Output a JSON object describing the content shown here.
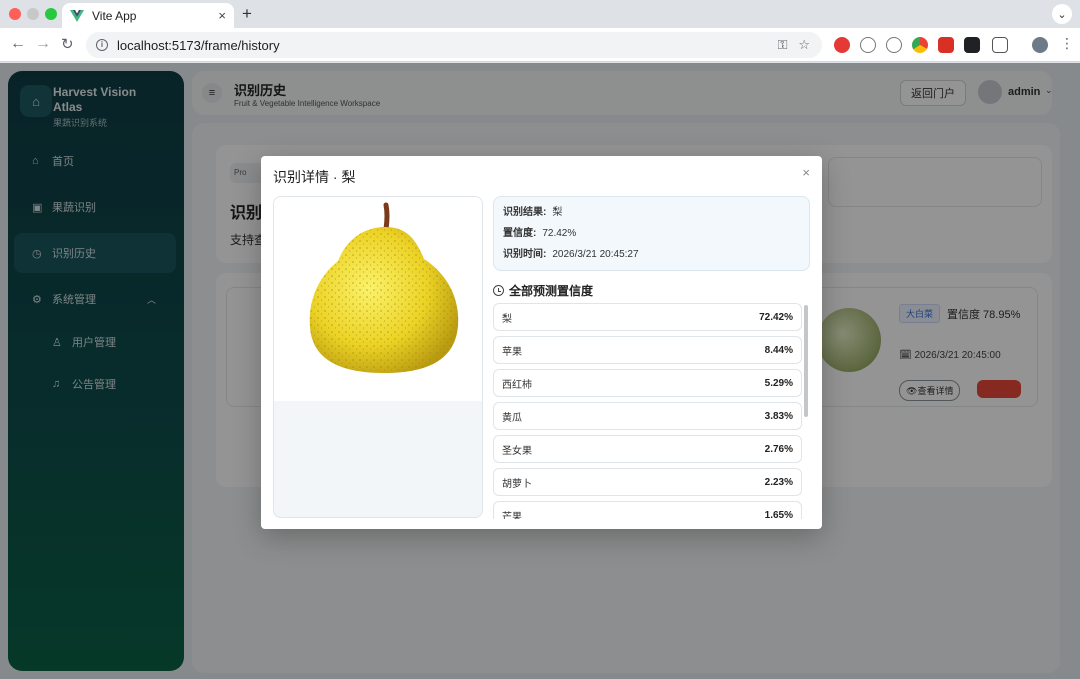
{
  "browser": {
    "tab_title": "Vite App",
    "tab_close": "×",
    "new_tab": "+",
    "url": "localhost:5173/frame/history"
  },
  "sidebar": {
    "brand_title_line1": "Harvest Vision",
    "brand_title_line2": "Atlas",
    "brand_subtitle": "果蔬识别系统",
    "items": [
      {
        "label": "首页"
      },
      {
        "label": "果蔬识别"
      },
      {
        "label": "识别历史"
      },
      {
        "label": "系统管理"
      },
      {
        "label": "用户管理"
      },
      {
        "label": "公告管理"
      }
    ]
  },
  "header": {
    "title": "识别历史",
    "subtitle": "Fruit & Vegetable Intelligence Workspace",
    "portal_button": "返回门户",
    "user": "admin"
  },
  "page": {
    "pill_text": "Pro",
    "title": "识别",
    "desc": "支持查"
  },
  "history_card": {
    "tag": "大白菜",
    "confidence": "置信度 78.95%",
    "time": "2026/3/21 20:45:00",
    "view_button": "查看详情"
  },
  "modal": {
    "title": "识别详情 · 梨",
    "close": "×",
    "result_label": "识别结果:",
    "result_value": "梨",
    "confidence_label": "置信度:",
    "confidence_value": "72.42%",
    "time_label": "识别时间:",
    "time_value": "2026/3/21 20:45:27",
    "predictions_title": "全部预测置信度",
    "predictions": [
      {
        "name": "梨",
        "value": "72.42%"
      },
      {
        "name": "苹果",
        "value": "8.44%"
      },
      {
        "name": "西红柿",
        "value": "5.29%"
      },
      {
        "name": "黄瓜",
        "value": "3.83%"
      },
      {
        "name": "圣女果",
        "value": "2.76%"
      },
      {
        "name": "胡萝卜",
        "value": "2.23%"
      },
      {
        "name": "芒果",
        "value": "1.65%"
      }
    ]
  }
}
